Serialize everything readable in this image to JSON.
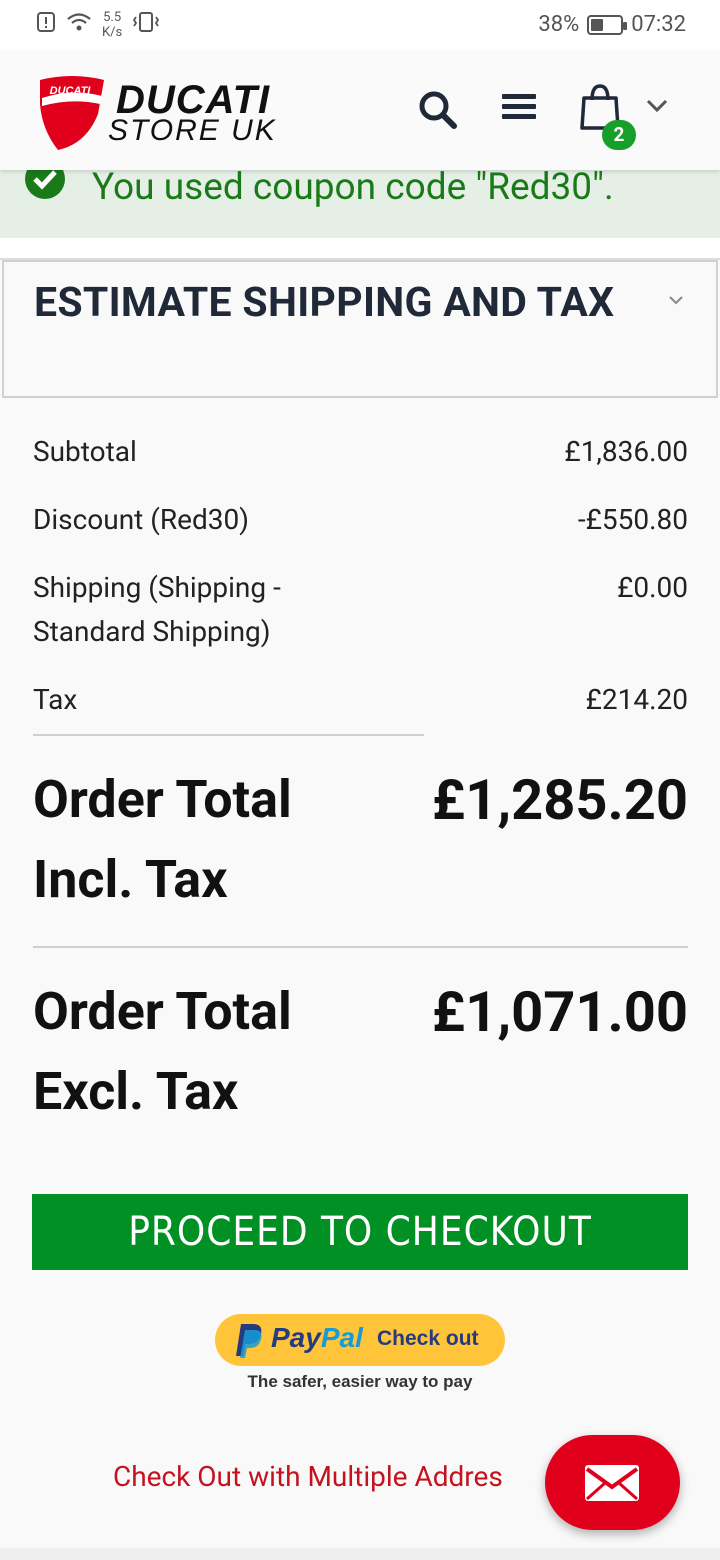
{
  "status_bar": {
    "speed_value": "5.5",
    "speed_unit": "K/s",
    "battery": "38%",
    "time": "07:32"
  },
  "header": {
    "logo_badge": "DUCATI",
    "logo_line1": "DUCATI",
    "logo_line2": "STORE UK",
    "cart_count": "2"
  },
  "coupon_message": "You used coupon code \"Red30\".",
  "summary": {
    "section_title": "ESTIMATE SHIPPING AND TAX",
    "subtotal_label": "Subtotal",
    "subtotal_value": "£1,836.00",
    "discount_label": "Discount (Red30)",
    "discount_value": "-£550.80",
    "shipping_label": "Shipping (Shipping - Standard Shipping)",
    "shipping_value": "£0.00",
    "tax_label": "Tax",
    "tax_value": "£214.20",
    "total_incl_label": "Order Total Incl. Tax",
    "total_incl_value": "£1,285.20",
    "total_excl_label": "Order Total Excl. Tax",
    "total_excl_value": "£1,071.00"
  },
  "actions": {
    "checkout_label": "PROCEED TO CHECKOUT",
    "paypal_pay": "Pay",
    "paypal_pal": "Pal",
    "paypal_checkout": "Check out",
    "paypal_tagline": "The safer, easier way to pay",
    "multi_address_label": "Check Out with Multiple Addres"
  },
  "colors": {
    "brand_red": "#e0001b",
    "checkout_green": "#009024",
    "coupon_green": "#1a7a1a",
    "paypal_yellow": "#ffc439"
  }
}
